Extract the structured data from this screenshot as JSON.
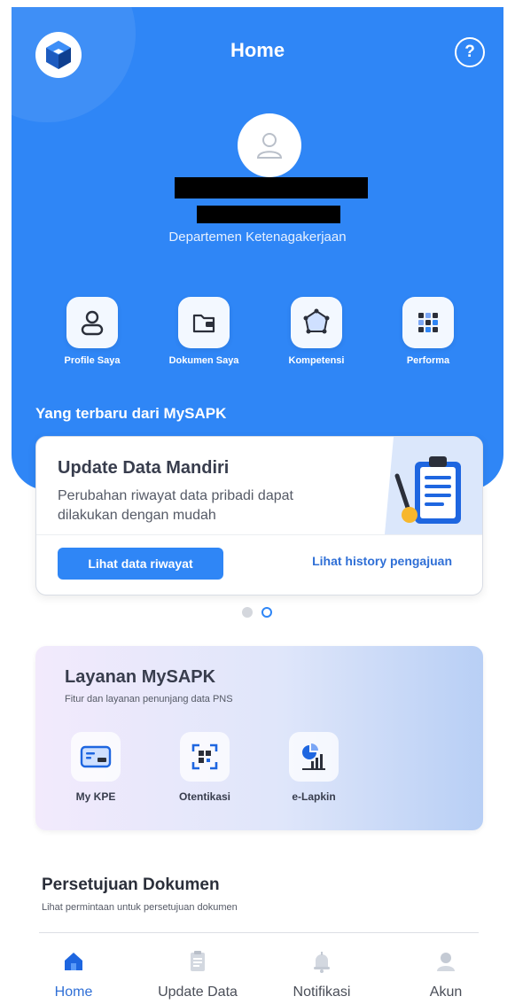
{
  "header": {
    "title": "Home",
    "help_glyph": "?",
    "logo_icon": "mysapk-logo-icon",
    "department": "Departemen Ketenagakerjaan"
  },
  "quick_menu": [
    {
      "label": "Profile Saya",
      "icon": "user-icon"
    },
    {
      "label": "Dokumen Saya",
      "icon": "folder-icon"
    },
    {
      "label": "Kompetensi",
      "icon": "competency-icon"
    },
    {
      "label": "Performa",
      "icon": "grid-icon"
    }
  ],
  "news": {
    "section_title": "Yang terbaru dari MySAPK",
    "card": {
      "title": "Update Data Mandiri",
      "description": "Perubahan riwayat data pribadi dapat dilakukan dengan mudah",
      "primary_button": "Lihat data riwayat",
      "secondary_link": "Lihat history pengajuan"
    },
    "carousel": {
      "count": 2,
      "active_index": 1
    }
  },
  "layanan": {
    "title": "Layanan MySAPK",
    "subtitle": "Fitur dan layanan penunjang data PNS",
    "items": [
      {
        "label": "My KPE",
        "icon": "id-card-icon"
      },
      {
        "label": "Otentikasi",
        "icon": "qr-scan-icon"
      },
      {
        "label": "e-Lapkin",
        "icon": "report-chart-icon"
      }
    ]
  },
  "persetujuan": {
    "title": "Persetujuan Dokumen",
    "subtitle": "Lihat permintaan untuk persetujuan dokumen"
  },
  "bottom_nav": {
    "active": "Home",
    "items": [
      {
        "label": "Home",
        "icon": "home-icon"
      },
      {
        "label": "Update Data",
        "icon": "document-icon"
      },
      {
        "label": "Notifikasi",
        "icon": "bell-icon"
      },
      {
        "label": "Akun",
        "icon": "account-icon"
      }
    ]
  },
  "colors": {
    "primary": "#2f86f6",
    "link": "#2f6fd6",
    "nav_inactive_icon": "#c4cad4"
  }
}
